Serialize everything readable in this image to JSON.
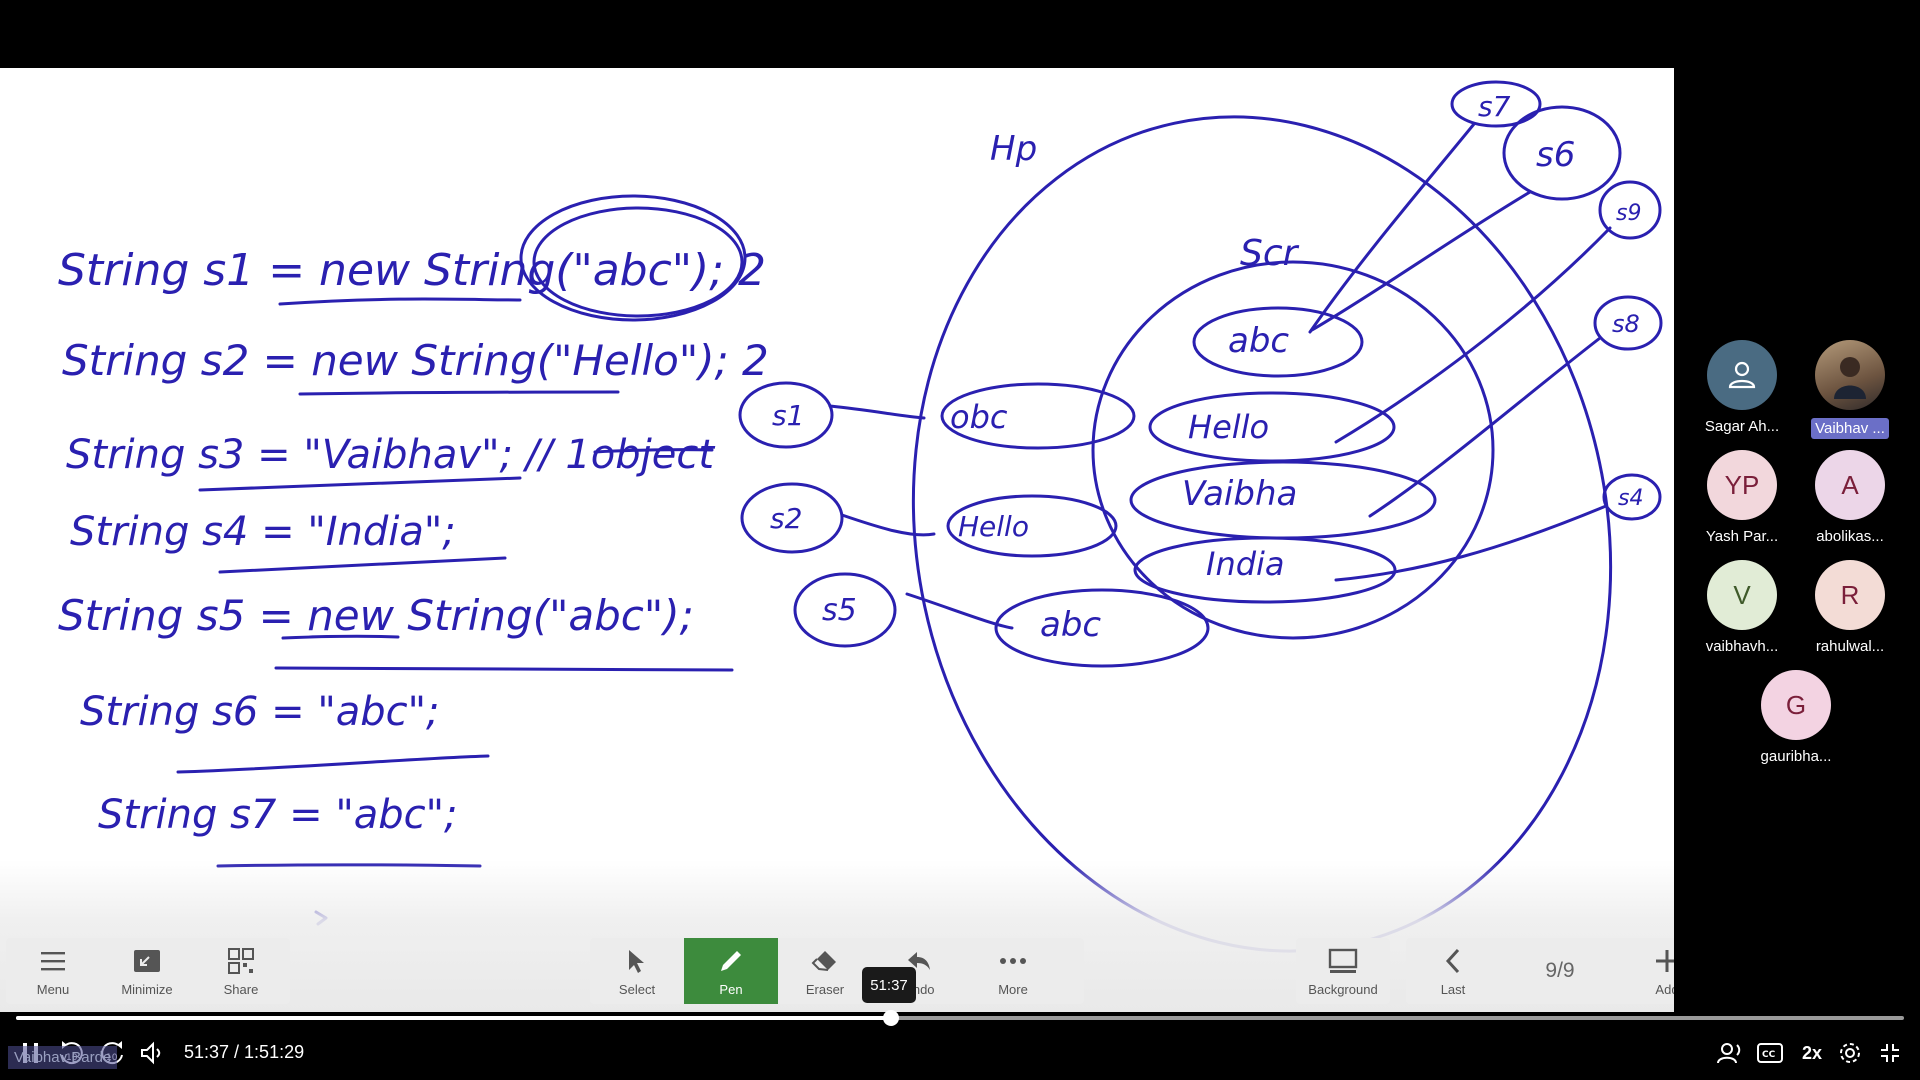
{
  "toolbar": {
    "left": [
      {
        "label": "Menu",
        "icon": "menu-icon"
      },
      {
        "label": "Minimize",
        "icon": "minimize-icon"
      },
      {
        "label": "Share",
        "icon": "share-icon"
      }
    ],
    "center": [
      {
        "label": "Select",
        "icon": "select-arrow-icon",
        "active": false
      },
      {
        "label": "Pen",
        "icon": "pen-icon",
        "active": true
      },
      {
        "label": "Eraser",
        "icon": "eraser-icon",
        "active": false
      },
      {
        "label": "Undo",
        "icon": "undo-icon",
        "active": false
      },
      {
        "label": "More",
        "icon": "more-icon",
        "active": false
      }
    ],
    "background_label": "Background",
    "last_label": "Last",
    "page_indicator": "9/9",
    "add_label": "Add",
    "active_color": "#3d8b3d"
  },
  "player": {
    "tooltip_time": "51:37",
    "time_display": "51:37 / 1:51:29",
    "progress": 0.4637,
    "speed_label": "2x",
    "presenter_name": "Vaibhav Barde"
  },
  "participants": [
    {
      "name": "Sagar Ah...",
      "initials": "",
      "color": "#4a6b82",
      "icon": "person-icon"
    },
    {
      "name": "Vaibhav ...",
      "initials": "",
      "color": "#8a6b4a",
      "icon": "user-photo",
      "highlight": true
    },
    {
      "name": "Yash Par...",
      "initials": "YP",
      "color": "#f2d7dc"
    },
    {
      "name": "abolikas...",
      "initials": "A",
      "color": "#ecd6e8"
    },
    {
      "name": "vaibhavh...",
      "initials": "V",
      "color": "#e1ecd6"
    },
    {
      "name": "rahulwal...",
      "initials": "R",
      "color": "#f3dcd6"
    },
    {
      "name": "gauribha...",
      "initials": "G",
      "color": "#f3d3e2"
    }
  ],
  "whiteboard": {
    "ink_color": "#2a20b0",
    "code_lines": [
      "String s1 = new String(\"abc\");   2",
      "String s2 = new String(\"Hello\");  2",
      "String s3 = \"Vaibhav\";  // 1object",
      "String s4 = \"India\";",
      "String s5 = new String(\"abc\");",
      "String s6 = \"abc\";",
      "String s7 = \"abc\";"
    ],
    "heap_label": "Hp",
    "scp_label": "Scr",
    "refs": [
      "s1",
      "s2",
      "s5",
      "s7",
      "s6",
      "s9",
      "s8",
      "s4"
    ],
    "heap_objects": [
      "obc",
      "Hello",
      "abc"
    ],
    "scp_objects": [
      "abc",
      "Hello",
      "Vaibha",
      "India"
    ]
  }
}
